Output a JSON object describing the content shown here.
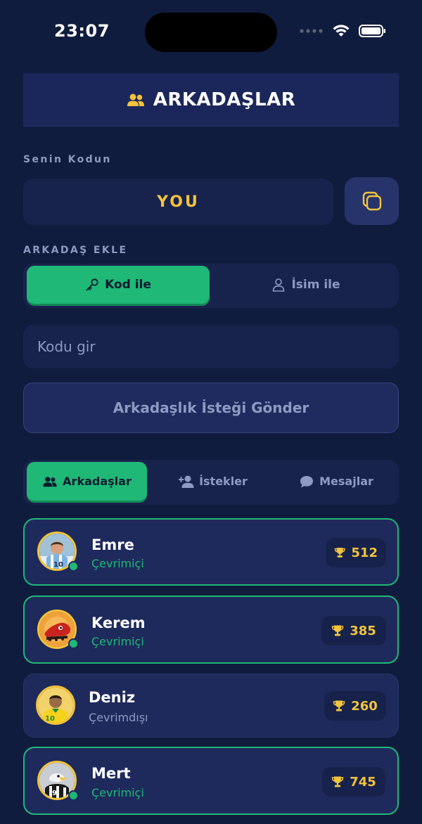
{
  "status_bar": {
    "time": "23:07"
  },
  "header": {
    "title": "ARKADAŞLAR"
  },
  "my_code": {
    "label": "Senin Kodun",
    "value": "YOU"
  },
  "add_friend": {
    "label": "ARKADAŞ EKLE",
    "tabs": [
      {
        "label": "Kod ile",
        "icon": "key-icon",
        "active": true
      },
      {
        "label": "İsim ile",
        "icon": "person-icon",
        "active": false
      }
    ],
    "input_placeholder": "Kodu gir",
    "input_value": "",
    "send_button": "Arkadaşlık İsteği Gönder"
  },
  "list_tabs": [
    {
      "label": "Arkadaşlar",
      "icon": "group-icon",
      "active": true
    },
    {
      "label": "İstekler",
      "icon": "add-person-icon",
      "active": false
    },
    {
      "label": "Mesajlar",
      "icon": "chat-icon",
      "active": false
    }
  ],
  "friends": [
    {
      "name": "Emre",
      "status": "Çevrimiçi",
      "online": true,
      "score": "512",
      "avatar": "football-player-blue-white-jersey"
    },
    {
      "name": "Kerem",
      "status": "Çevrimiçi",
      "online": true,
      "score": "385",
      "avatar": "red-football-boot"
    },
    {
      "name": "Deniz",
      "status": "Çevrimdışı",
      "online": false,
      "score": "260",
      "avatar": "football-player-yellow-jersey"
    },
    {
      "name": "Mert",
      "status": "Çevrimiçi",
      "online": true,
      "score": "745",
      "avatar": "eagle-black-white-jersey"
    }
  ],
  "colors": {
    "background": "#101c3d",
    "accent_green": "#1fb877",
    "gold": "#f3c33c",
    "muted_text": "#8d9ac2",
    "card": "#1e2a5c"
  }
}
